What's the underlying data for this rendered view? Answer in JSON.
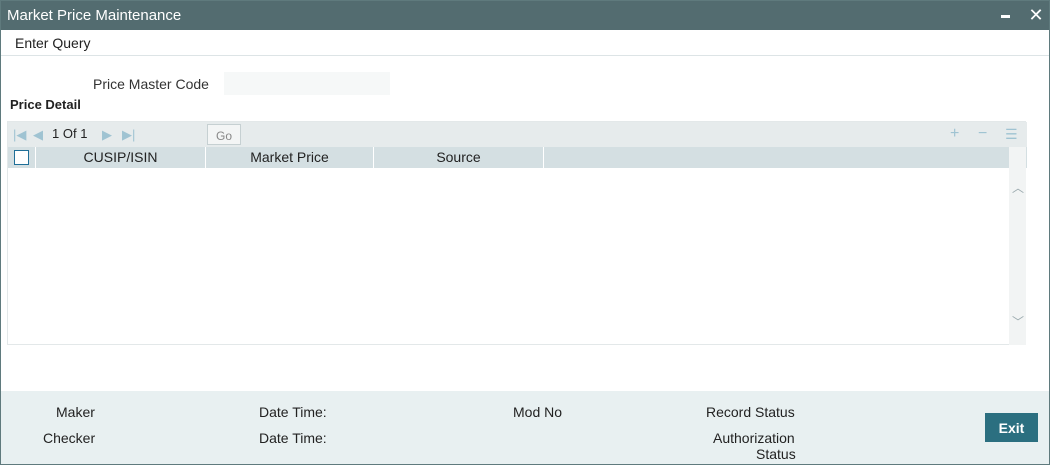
{
  "window": {
    "title": "Market Price Maintenance"
  },
  "toolbar": {
    "enter_query": "Enter Query"
  },
  "form": {
    "price_master_code_label": "Price Master Code",
    "price_master_code_value": ""
  },
  "price_detail": {
    "title": "Price Detail",
    "pager": {
      "current": "1",
      "of_label": "Of",
      "total": "1",
      "go_label": "Go"
    },
    "columns": [
      "CUSIP/ISIN",
      "Market Price",
      "Source"
    ],
    "rows": []
  },
  "footer": {
    "maker_label": "Maker",
    "checker_label": "Checker",
    "date_time_label_1": "Date Time:",
    "date_time_label_2": "Date Time:",
    "mod_no_label": "Mod No",
    "record_status_label": "Record Status",
    "authorization_status_label_line1": "Authorization",
    "authorization_status_label_line2": "Status",
    "exit_label": "Exit"
  },
  "icons": {
    "minimize": "minimize-icon",
    "close": "close-icon",
    "first_page": "first-page-icon",
    "prev_page": "previous-page-icon",
    "next_page": "next-page-icon",
    "last_page": "last-page-icon",
    "add_row": "add-row-icon",
    "delete_row": "delete-row-icon",
    "single_view": "single-record-view-icon"
  },
  "colors": {
    "titlebar": "#536c70",
    "grid_header": "#d4dfe2",
    "pager_bg": "#e6ebec",
    "footer_bg": "#e8f0f1",
    "exit_button": "#2b6f80",
    "icon_tint": "#9fc3d2"
  }
}
